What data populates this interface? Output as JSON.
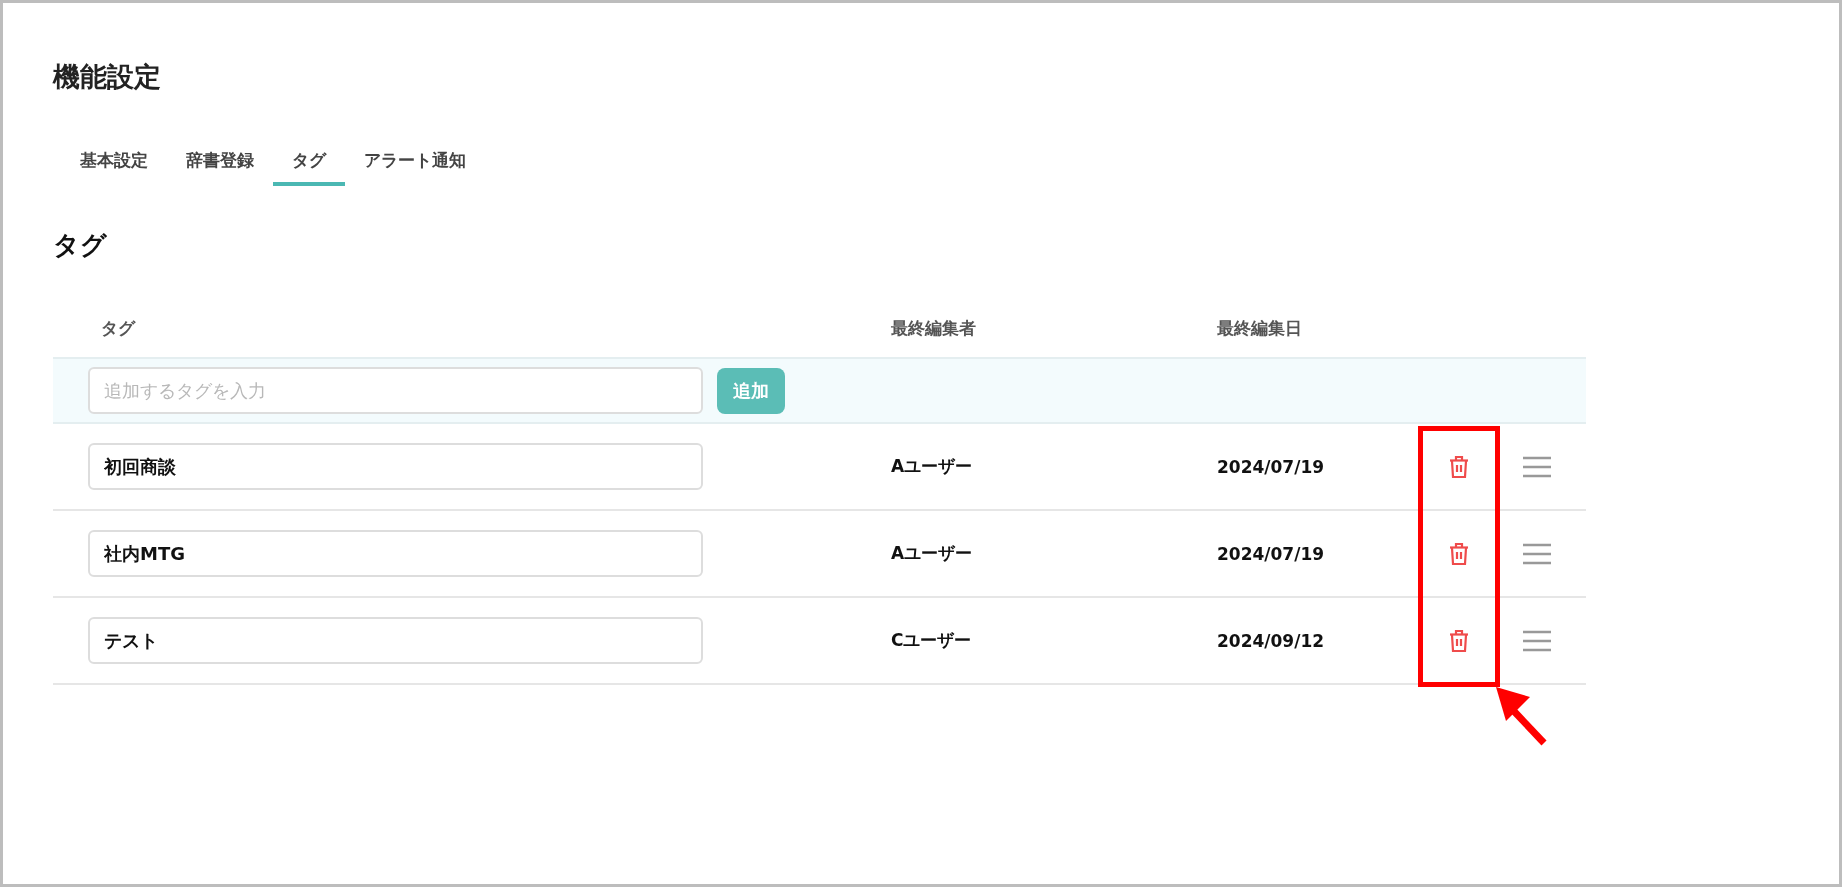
{
  "page": {
    "title": "機能設定"
  },
  "tabs": [
    {
      "label": "基本設定",
      "selected": false
    },
    {
      "label": "辞書登録",
      "selected": false
    },
    {
      "label": "タグ",
      "selected": true
    },
    {
      "label": "アラート通知",
      "selected": false
    }
  ],
  "section": {
    "title": "タグ"
  },
  "table": {
    "columns": [
      "タグ",
      "最終編集者",
      "最終編集日"
    ],
    "add_row": {
      "placeholder": "追加するタグを入力",
      "button": "追加"
    },
    "rows": [
      {
        "tag": "初回商談",
        "editor": "Aユーザー",
        "date": "2024/07/19"
      },
      {
        "tag": "社内MTG",
        "editor": "Aユーザー",
        "date": "2024/07/19"
      },
      {
        "tag": "テスト",
        "editor": "Cユーザー",
        "date": "2024/09/12"
      }
    ]
  },
  "annotation": {
    "kind": "highlight-with-arrow"
  }
}
